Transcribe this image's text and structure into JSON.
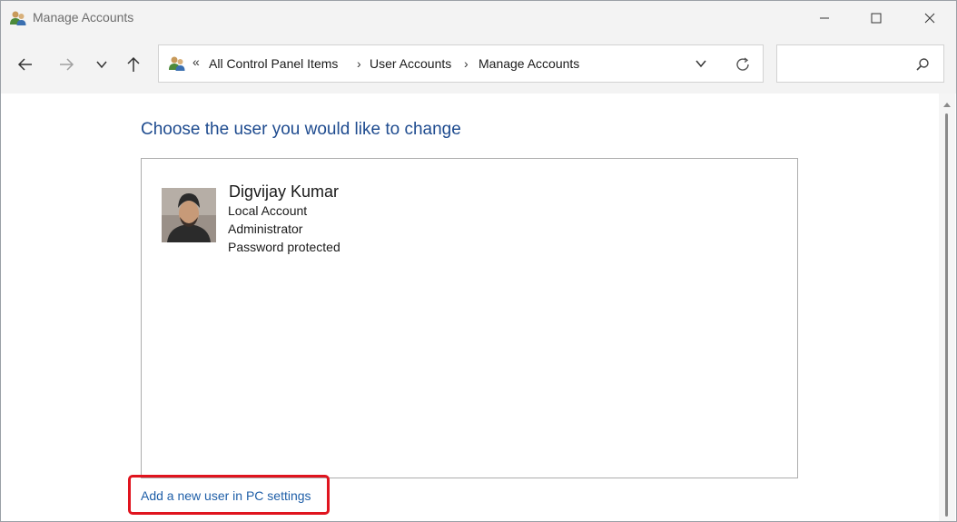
{
  "window": {
    "title": "Manage Accounts",
    "controls": {
      "minimize": "minimize",
      "maximize": "maximize",
      "close": "close"
    }
  },
  "nav": {
    "icons": [
      "back-arrow-icon",
      "forward-arrow-icon",
      "recent-locations-chevron-icon",
      "up-arrow-icon"
    ]
  },
  "address": {
    "overflow_glyph": "«",
    "breadcrumbs": [
      "All Control Panel Items",
      "User Accounts",
      "Manage Accounts"
    ],
    "separator": "›"
  },
  "search": {
    "value": "",
    "placeholder": ""
  },
  "content": {
    "heading": "Choose the user you would like to change",
    "accounts": [
      {
        "name": "Digvijay Kumar",
        "type": "Local Account",
        "role": "Administrator",
        "password": "Password protected"
      }
    ],
    "add_user_link": "Add a new user in PC settings"
  },
  "colors": {
    "heading": "#1e4b8f",
    "link": "#1f5fa8",
    "highlight": "#e0141e",
    "chrome": "#f3f3f3"
  }
}
